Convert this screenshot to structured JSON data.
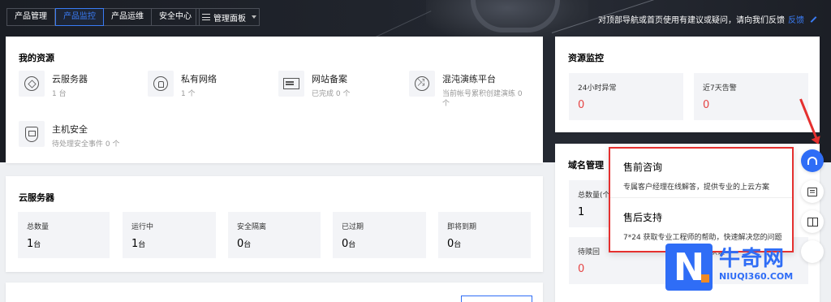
{
  "topnav": {
    "tabs": [
      {
        "label": "产品管理",
        "active": false
      },
      {
        "label": "产品监控",
        "active": true
      },
      {
        "label": "产品运维",
        "active": false
      },
      {
        "label": "安全中心",
        "active": false
      }
    ],
    "panel_button": "管理面板"
  },
  "feedback": {
    "text": "对顶部导航或首页使用有建议或疑问，请向我们反馈",
    "link": "反馈"
  },
  "my_resources": {
    "title": "我的资源",
    "items": [
      {
        "name": "云服务器",
        "sub": "1 台",
        "icon": "cube-icon"
      },
      {
        "name": "私有网络",
        "sub": "1 个",
        "icon": "lock-icon"
      },
      {
        "name": "网站备案",
        "sub": "已完成 0 个",
        "icon": "website-icon"
      },
      {
        "name": "混沌演练平台",
        "sub": "当前帐号累积创建演练 0 个",
        "icon": "swap-icon"
      },
      {
        "name": "主机安全",
        "sub": "待处理安全事件 0 个",
        "icon": "shield-icon"
      }
    ]
  },
  "cvm": {
    "title": "云服务器",
    "stats": [
      {
        "label": "总数量",
        "value": "1",
        "unit": "台"
      },
      {
        "label": "运行中",
        "value": "1",
        "unit": "台"
      },
      {
        "label": "安全隔离",
        "value": "0",
        "unit": "台"
      },
      {
        "label": "已过期",
        "value": "0",
        "unit": "台"
      },
      {
        "label": "即将到期",
        "value": "0",
        "unit": "台"
      }
    ]
  },
  "monitor": {
    "title": "资源监控",
    "stats": [
      {
        "label": "24小时异常",
        "value": "0"
      },
      {
        "label": "近7天告警",
        "value": "0"
      }
    ]
  },
  "domain": {
    "title": "域名管理",
    "total_label": "总数量(个",
    "total_value": "1",
    "pending_label": "待赎回",
    "pending_value": "0",
    "verify_label": "未认证",
    "verify_value": "0"
  },
  "popup": {
    "presale_title": "售前咨询",
    "presale_desc": "专属客户经理在线解答，提供专业的上云方案",
    "aftersale_title": "售后支持",
    "aftersale_desc": "7*24 获取专业工程师的帮助，快速解决您的问题"
  },
  "float_icons": [
    "headset-icon",
    "list-icon",
    "book-icon"
  ],
  "watermark": {
    "cn": "牛奇网",
    "en": "NIUQI360.COM",
    "letter": "N"
  },
  "colors": {
    "accent": "#2f6df6",
    "alert": "#e54545",
    "highlight_border": "#e5302f"
  }
}
